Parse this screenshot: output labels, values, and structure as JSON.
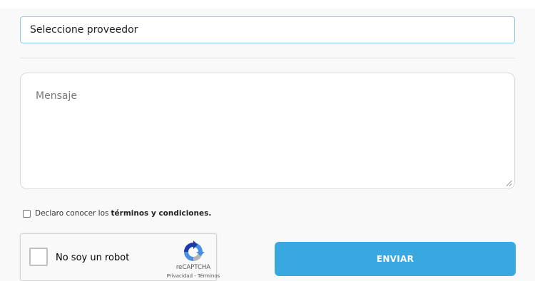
{
  "form": {
    "provider_select": {
      "value": "Seleccione proveedor"
    },
    "message": {
      "placeholder": "Mensaje"
    },
    "terms": {
      "prefix": "Declaro conocer los",
      "link": "términos y condiciones."
    },
    "recaptcha": {
      "label": "No soy un robot",
      "brand": "reCAPTCHA",
      "legal": "Privacidad - Términos"
    },
    "submit_label": "ENVIAR"
  },
  "colors": {
    "accent": "#3aa8e0",
    "select_border": "#8ec9e6"
  },
  "icons": {
    "recaptcha_logo": "recaptcha-logo-icon",
    "resize_handle": "resize-handle-icon"
  }
}
